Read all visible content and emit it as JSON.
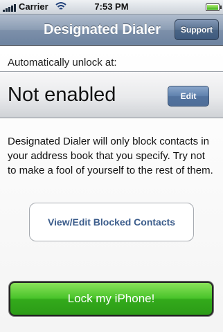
{
  "status_bar": {
    "carrier": "Carrier",
    "time": "7:53 PM",
    "icons": [
      "signal-bars-icon",
      "wifi-icon",
      "battery-icon"
    ]
  },
  "nav": {
    "title": "Designated Dialer",
    "support_label": "Support"
  },
  "unlock": {
    "label": "Automatically unlock at:",
    "status": "Not enabled",
    "edit_label": "Edit"
  },
  "description": "Designated Dialer will only block contacts in your address book that you specify. Try not to make a fool of yourself to the rest of them.",
  "buttons": {
    "view_contacts": "View/Edit Blocked Contacts",
    "lock": "Lock my iPhone!"
  },
  "colors": {
    "nav_bar": "#7d90aa",
    "accent_blue": "#52739f",
    "lock_green": "#3bb522"
  }
}
